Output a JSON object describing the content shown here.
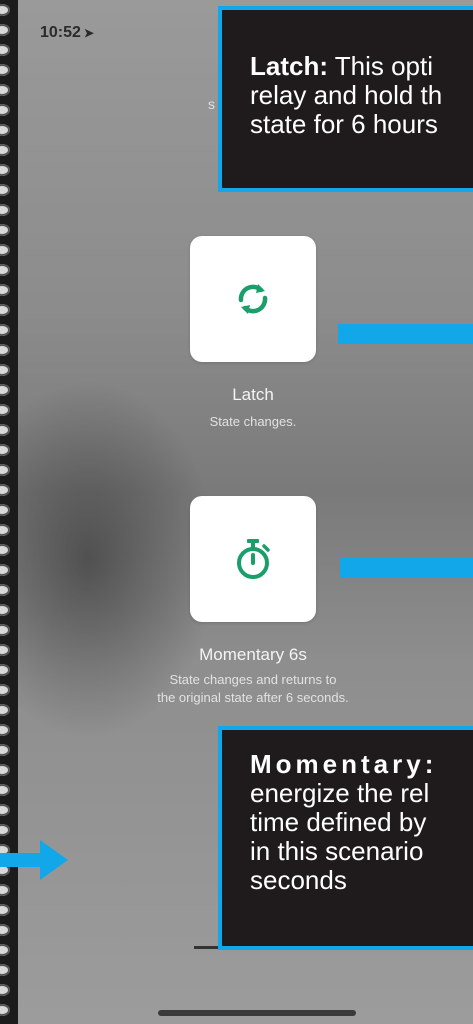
{
  "status_bar": {
    "time": "10:52",
    "location_icon": "location-arrow-icon"
  },
  "partial_text": "s",
  "options": [
    {
      "title": "Latch",
      "description": "State changes.",
      "icon": "sync-arrows-icon"
    },
    {
      "title": "Momentary 6s",
      "description_lines": [
        "State changes and returns to",
        "the original state after 6 seconds."
      ],
      "icon": "stopwatch-icon"
    }
  ],
  "callouts": {
    "latch": {
      "label": "Latch:",
      "text_line1": " This opti",
      "text_rest": "relay and hold th\nstate for 6 hours"
    },
    "momentary": {
      "label": "Momentary:",
      "text": "energize the rel\ntime defined by\nin this scenario\nseconds"
    }
  },
  "colors": {
    "accent": "#12a7e8",
    "icon_green": "#1a9e6a",
    "callout_bg": "#1f1b1d"
  }
}
